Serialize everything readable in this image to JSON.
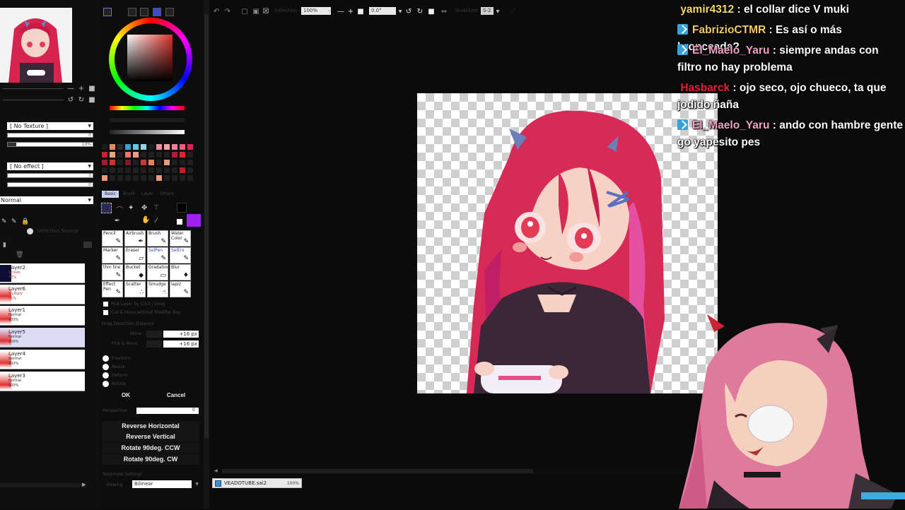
{
  "app": {
    "file_tab": {
      "name": "VEADOTUBE.sai2",
      "zoom": "100%"
    }
  },
  "colors": {
    "accent_blue": "#c7d1f3",
    "chat_badge": "#3aa0d8",
    "primary_color": "#000000",
    "secondary_color": "#a020f0"
  },
  "toolbar": {
    "selection_label": "Selection",
    "zoom_value": "100%",
    "angle_value": "0.0°",
    "stabilizer_label": "Stabilizer",
    "stabilizer_value": "S-2"
  },
  "left_panel": {
    "texture_select": "[ No Texture ]",
    "texture_slider_1": "0",
    "texture_slider_2": "10%",
    "effect_select": "[ No effect ]",
    "effect_slider_1": "1",
    "effect_slider_2": "0",
    "blend_mode": "Normal",
    "selection_source_label": "Selection Source",
    "layers": [
      {
        "name": "Layer2",
        "mode": "Screen",
        "opacity": "70%"
      },
      {
        "name": "Layer6",
        "mode": "Multiply",
        "opacity": "35%"
      },
      {
        "name": "Layer1",
        "mode": "Normal",
        "opacity": "100%"
      },
      {
        "name": "Layer5",
        "mode": "Normal",
        "opacity": "100%"
      },
      {
        "name": "Layer4",
        "mode": "Normal",
        "opacity": "100%"
      },
      {
        "name": "Layer3",
        "mode": "Normal",
        "opacity": "100%"
      }
    ]
  },
  "tool_panel": {
    "tabs": [
      "Basic",
      "Brush",
      "Layer",
      "Others"
    ],
    "tools": [
      {
        "label": "Pencil",
        "glyph": "✎"
      },
      {
        "label": "Airbrush",
        "glyph": "✒"
      },
      {
        "label": "Brush",
        "glyph": "✎"
      },
      {
        "label": "Water Color",
        "glyph": "✎"
      },
      {
        "label": "Marker",
        "glyph": "✎"
      },
      {
        "label": "Eraser",
        "glyph": "▱"
      },
      {
        "label": "SelPen",
        "glyph": "✎"
      },
      {
        "label": "SelErs",
        "glyph": "✎"
      },
      {
        "label": "thin line",
        "glyph": "✎"
      },
      {
        "label": "Bucket",
        "glyph": "◆"
      },
      {
        "label": "Gradation",
        "glyph": "▭"
      },
      {
        "label": "Blur",
        "glyph": "♦"
      },
      {
        "label": "Effect Pen",
        "glyph": "✎"
      },
      {
        "label": "Scatter",
        "glyph": "∴"
      },
      {
        "label": "Smudge",
        "glyph": "☝"
      },
      {
        "label": "lapiz",
        "glyph": "✎"
      }
    ],
    "pick_layer_label": "Pick Layer by Click / Drag",
    "cut_move_label": "Cut & Move without Modifier Key",
    "drag_detection_label": "Drag Detection Distance",
    "move_label": "Move",
    "move_value": "+16 px",
    "pick_move_label": "Pick & Move",
    "pick_move_value": "+16 px",
    "transform_modes": [
      "Freeform",
      "Resize",
      "Deform",
      "Rotate"
    ],
    "ok_label": "OK",
    "cancel_label": "Cancel",
    "perspective_label": "Perspective",
    "actions": [
      "Reverse Horizontal",
      "Reverse Vertical",
      "Rotate 90deg. CCW",
      "Rotate 90deg. CW"
    ],
    "resample_label": "Resample Settings",
    "bilinear_label": "Bilinear",
    "viewing_label": "Viewing"
  },
  "chat": [
    {
      "user": "yamir4312",
      "color": "#f5d86b",
      "badge": false,
      "text": "el collar dice V muki"
    },
    {
      "user": "FabrizioCTMR",
      "color": "#f4c96a",
      "badge": true,
      "text": "Es así o más bronceada?"
    },
    {
      "user": "El_Maelo_Yaru",
      "color": "#f2a0c6",
      "badge": true,
      "text": "siempre andas con filtro no hay problema"
    },
    {
      "user": "Hasbarck",
      "color": "#e0213a",
      "badge": false,
      "text": "ojo seco, ojo chueco, ta que jodido ñaña"
    },
    {
      "user": "El_Maelo_Yaru",
      "color": "#f2a0c6",
      "badge": true,
      "text": "ando con hambre gente go yapesito pes"
    }
  ]
}
